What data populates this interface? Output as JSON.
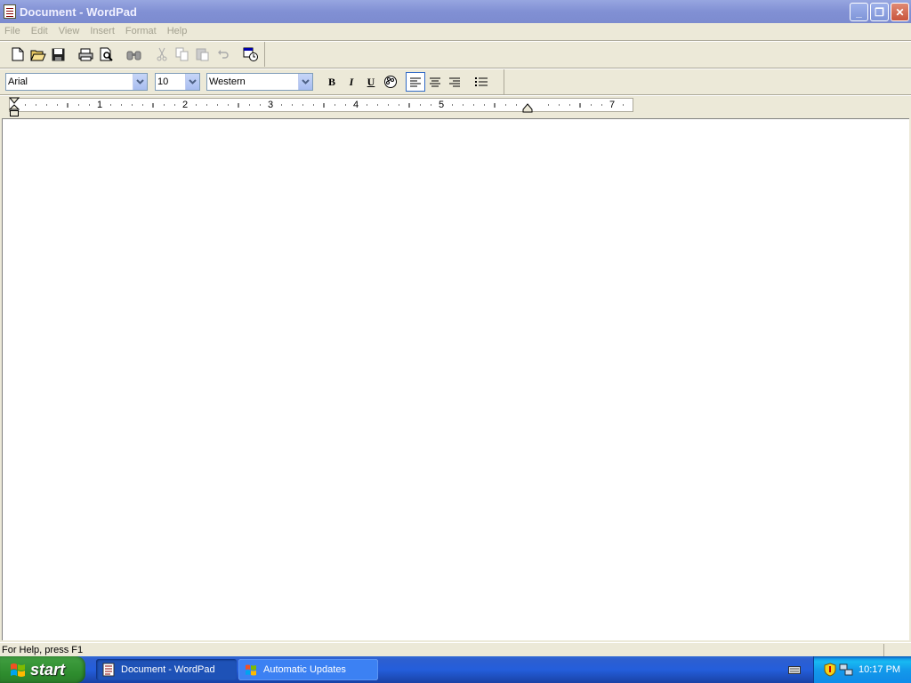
{
  "window": {
    "title": "Document - WordPad",
    "buttons": {
      "minimize": "_",
      "restore": "❐",
      "close": "✕"
    }
  },
  "menu": [
    "File",
    "Edit",
    "View",
    "Insert",
    "Format",
    "Help"
  ],
  "toolbar": {
    "icons": [
      "new-icon",
      "open-icon",
      "save-icon",
      "print-icon",
      "print-preview-icon",
      "find-icon",
      "cut-icon",
      "copy-icon",
      "paste-icon",
      "undo-icon",
      "date-time-icon"
    ]
  },
  "format_bar": {
    "font": "Arial",
    "size": "10",
    "script": "Western",
    "bold": "B",
    "italic": "I",
    "underline": "U"
  },
  "ruler": {
    "labels": [
      "1",
      "2",
      "3",
      "4",
      "5",
      "7"
    ]
  },
  "status": {
    "text": "For Help, press F1"
  },
  "taskbar": {
    "start": "start",
    "tasks": [
      "Document - WordPad",
      "Automatic Updates"
    ],
    "clock": "10:17 PM"
  },
  "colors": {
    "titlebar": "#8190d4",
    "taskbar": "#245edb",
    "start": "#3c9a3c",
    "tray": "#139eeb"
  }
}
